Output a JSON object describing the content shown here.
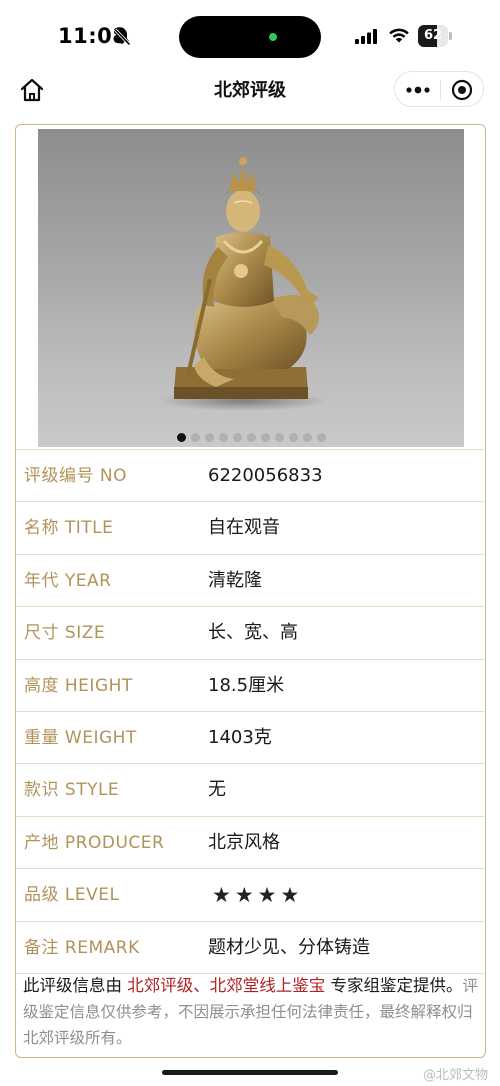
{
  "status_bar": {
    "time": "11:08",
    "battery": "62",
    "battery_level": 0.62
  },
  "nav": {
    "title": "北郊评级"
  },
  "carousel": {
    "total_slides": 11,
    "active_index": 0
  },
  "fields": [
    {
      "label": "评级编号 NO",
      "value": "6220056833"
    },
    {
      "label": "名称 TITLE",
      "value": "自在观音"
    },
    {
      "label": "年代 YEAR",
      "value": "清乾隆"
    },
    {
      "label": "尺寸 SIZE",
      "value": "长、宽、高"
    },
    {
      "label": "高度 HEIGHT",
      "value": "18.5厘米"
    },
    {
      "label": "重量 WEIGHT",
      "value": "1403克"
    },
    {
      "label": "款识 STYLE",
      "value": "无"
    },
    {
      "label": "产地 PRODUCER",
      "value": "北京风格"
    },
    {
      "label": "品级 LEVEL",
      "value": "★★★★"
    },
    {
      "label": "备注 REMARK",
      "value": "题材少见、分体铸造"
    }
  ],
  "disclaimer": {
    "prefix": "此评级信息由 ",
    "highlight": "北郊评级、北郊堂线上鉴宝",
    "middle": " 专家组鉴定提供。",
    "note": "评级鉴定信息仅供参考，不因展示承担任何法律责任，最终解释权归北郊评级所有。"
  },
  "watermark": "@北郊文物",
  "colors": {
    "accent_gold": "#b1935a",
    "card_border": "#cdb68c",
    "highlight_red": "#b22222"
  }
}
